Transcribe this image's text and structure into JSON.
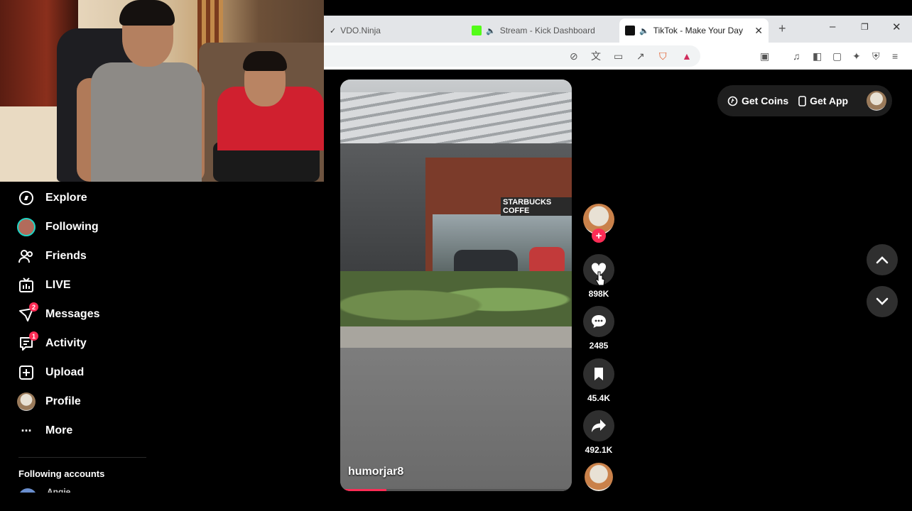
{
  "browser": {
    "tabs": [
      {
        "label": "VDO.Ninja",
        "active": false
      },
      {
        "label": "Stream - Kick Dashboard",
        "active": false
      },
      {
        "label": "TikTok - Make Your Day",
        "active": true
      }
    ],
    "new_tab_label": "+",
    "window_controls": {
      "minimize": "–",
      "restore": "❐",
      "close": "✕"
    }
  },
  "header": {
    "get_coins_label": "Get Coins",
    "get_app_label": "Get App"
  },
  "sidebar": {
    "items": [
      {
        "label": "Explore",
        "icon": "compass-icon"
      },
      {
        "label": "Following",
        "icon": "avatar"
      },
      {
        "label": "Friends",
        "icon": "friends-icon"
      },
      {
        "label": "LIVE",
        "icon": "live-icon"
      },
      {
        "label": "Messages",
        "icon": "messages-icon",
        "badge": "2"
      },
      {
        "label": "Activity",
        "icon": "activity-icon",
        "badge": "1"
      },
      {
        "label": "Upload",
        "icon": "upload-icon"
      },
      {
        "label": "Profile",
        "icon": "avatar"
      },
      {
        "label": "More",
        "icon": "more-icon"
      }
    ],
    "following_header": "Following accounts",
    "following_first": "Angie"
  },
  "video": {
    "username": "humorjar8",
    "store_sign": "STARBUCKS COFFE",
    "progress": 0.2
  },
  "actions": {
    "likes": "898K",
    "comments": "2485",
    "saves": "45.4K",
    "shares": "492.1K",
    "follow_label": "+"
  },
  "colors": {
    "accent": "#fe2c55",
    "background": "#000000",
    "action_circle": "#2f2f2f"
  }
}
